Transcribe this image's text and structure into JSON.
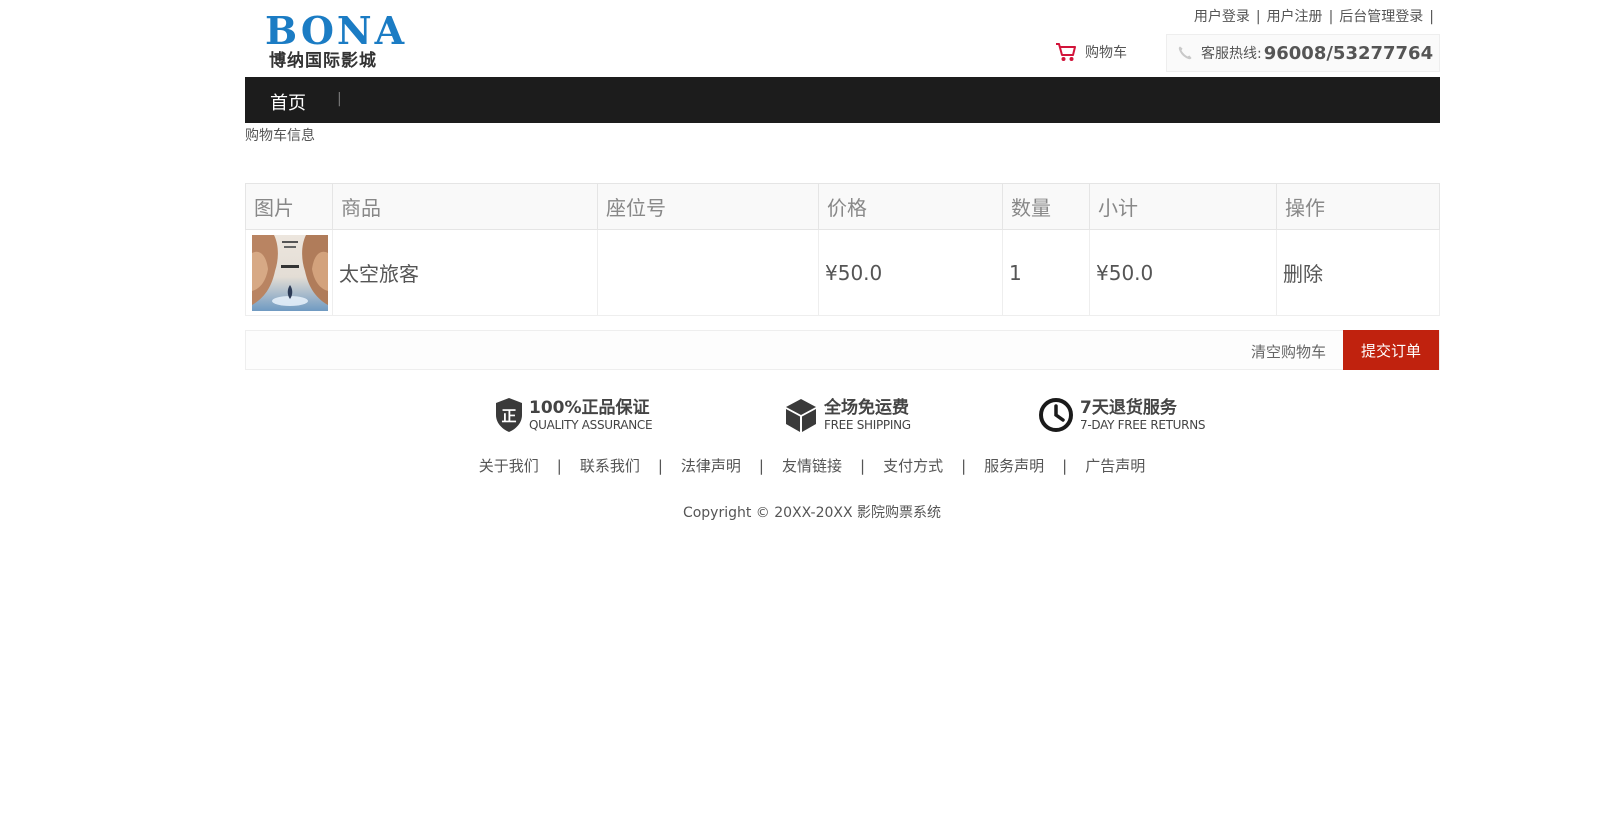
{
  "header": {
    "logo_en": "BONA",
    "logo_cn": "博纳国际影城",
    "top_links": [
      "用户登录",
      "用户注册",
      "后台管理登录"
    ],
    "separator": "|",
    "cart_label": "购物车",
    "hotline_label": "客服热线:",
    "hotline_number": "96008/53277764"
  },
  "nav": {
    "items": [
      "首页"
    ],
    "divider": "|"
  },
  "breadcrumb": "购物车信息",
  "cart": {
    "columns": [
      "图片",
      "商品",
      "座位号",
      "价格",
      "数量",
      "小计",
      "操作"
    ],
    "rows": [
      {
        "name": "太空旅客",
        "seat": "",
        "price": "¥50.0",
        "quantity": "1",
        "subtotal": "¥50.0",
        "action": "删除"
      }
    ],
    "clear_label": "清空购物车",
    "submit_label": "提交订单"
  },
  "guarantees": [
    {
      "title": "100%正品保证",
      "subtitle": "QUALITY ASSURANCE",
      "icon": "shield-icon",
      "icon_char": "正"
    },
    {
      "title": "全场免运费",
      "subtitle": "FREE SHIPPING",
      "icon": "box-icon"
    },
    {
      "title": "7天退货服务",
      "subtitle": "7-DAY FREE RETURNS",
      "icon": "clock-icon"
    }
  ],
  "footer": {
    "links": [
      "关于我们",
      "联系我们",
      "法律声明",
      "友情链接",
      "支付方式",
      "服务声明",
      "广告声明"
    ],
    "separator": "|",
    "copyright": "Copyright © 20XX-20XX 影院购票系统"
  },
  "colors": {
    "nav_bg": "#1c1c1c",
    "submit_bg": "#c0220e",
    "cart_icon": "#d2143a",
    "logo_blue": "#1b7cc4"
  }
}
